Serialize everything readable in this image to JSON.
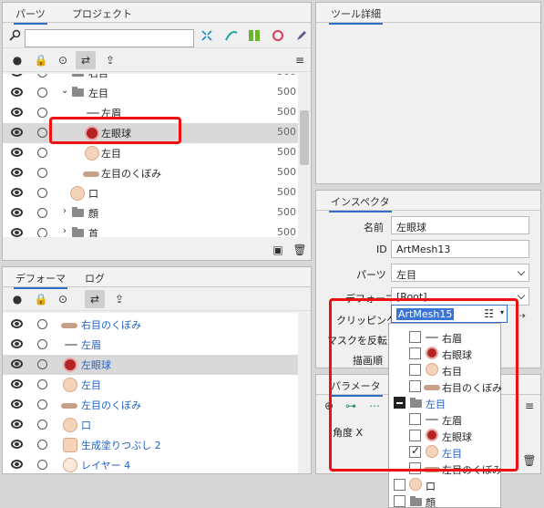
{
  "parts_panel": {
    "tabs": [
      "パーツ",
      "プロジェクト"
    ],
    "rows": [
      {
        "name": "右目",
        "value": "500",
        "type": "folder",
        "partial": true
      },
      {
        "name": "左目",
        "value": "500",
        "type": "folder"
      },
      {
        "name": "左眉",
        "value": "500",
        "type": "brow"
      },
      {
        "name": "左眼球",
        "value": "500",
        "type": "eye",
        "selected": true
      },
      {
        "name": "左目",
        "value": "500",
        "type": "skin"
      },
      {
        "name": "左目のくぼみ",
        "value": "500",
        "type": "brow"
      },
      {
        "name": "口",
        "value": "500",
        "type": "mouth"
      },
      {
        "name": "顔",
        "value": "500",
        "type": "folder"
      },
      {
        "name": "首",
        "value": "500",
        "type": "folder"
      }
    ]
  },
  "tool_detail": {
    "tab": "ツール詳細"
  },
  "deformer_panel": {
    "tabs": [
      "デフォーマ",
      "ログ"
    ],
    "rows": [
      {
        "name": "右目のくぼみ"
      },
      {
        "name": "左眉"
      },
      {
        "name": "左眼球",
        "selected": true
      },
      {
        "name": "左目"
      },
      {
        "name": "左目のくぼみ"
      },
      {
        "name": "口"
      },
      {
        "name": "生成塗りつぶし 2"
      },
      {
        "name": "レイヤー 4"
      }
    ]
  },
  "inspector": {
    "tab": "インスペクタ",
    "name_label": "名前",
    "name_value": "左眼球",
    "id_label": "ID",
    "id_value": "ArtMesh13",
    "parts_label": "パーツ",
    "parts_value": "左目",
    "deformer_label": "デフォーマ",
    "deformer_value": "[Root]",
    "clipping_label": "クリッピング",
    "clipping_value": "ArtMesh15",
    "mask_invert_label": "マスクを反転",
    "draw_order_label": "描画順"
  },
  "parameter_panel": {
    "tab": "パラメータ",
    "param_label": "角度 X"
  },
  "clipping_popup": {
    "items": [
      {
        "name": "右眉",
        "indent": 1,
        "checked": false
      },
      {
        "name": "右眼球",
        "indent": 1,
        "checked": false
      },
      {
        "name": "右目",
        "indent": 1,
        "checked": false
      },
      {
        "name": "右目のくぼみ",
        "indent": 1,
        "checked": false
      },
      {
        "name": "左目",
        "indent": 0,
        "checked": "minus",
        "folder": true
      },
      {
        "name": "左眉",
        "indent": 1,
        "checked": false
      },
      {
        "name": "左眼球",
        "indent": 1,
        "checked": false
      },
      {
        "name": "左目",
        "indent": 1,
        "checked": true
      },
      {
        "name": "左目のくぼみ",
        "indent": 1,
        "checked": false
      },
      {
        "name": "口",
        "indent": 0,
        "checked": false
      },
      {
        "name": "顔",
        "indent": 0,
        "checked": false,
        "folder": true
      }
    ]
  },
  "colors": {
    "accent": "#2f6fc9",
    "highlight": "#e11111",
    "blue_text": "#2361c5"
  }
}
